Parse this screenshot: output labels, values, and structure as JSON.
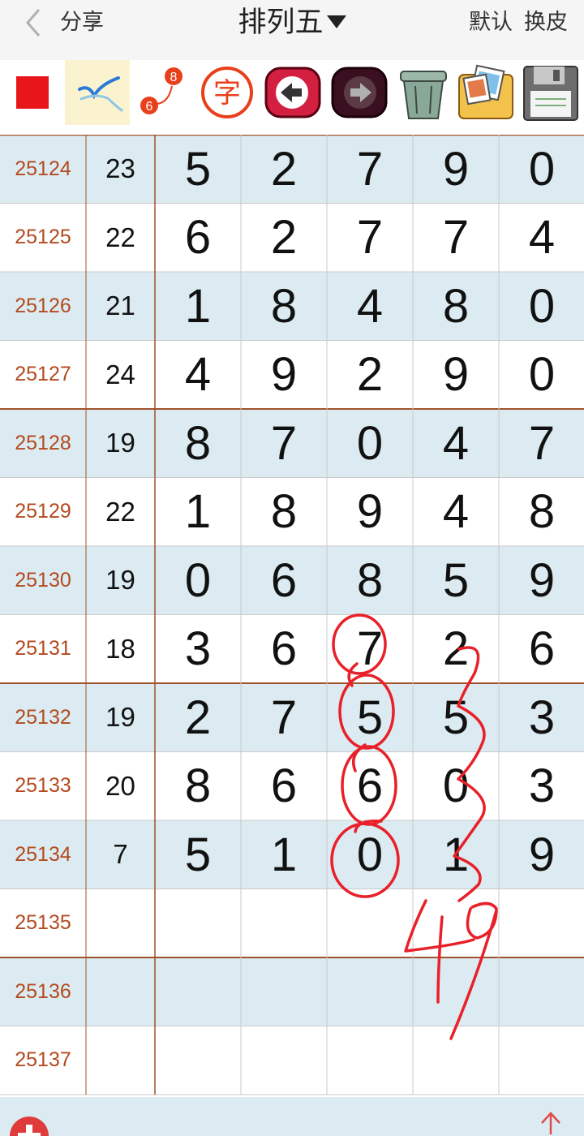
{
  "header": {
    "share_label": "分享",
    "title": "排列五",
    "default_label": "默认",
    "skin_label": "换皮"
  },
  "toolbar": {
    "items": [
      {
        "icon": "red-square-icon"
      },
      {
        "icon": "pen-check-icon"
      },
      {
        "icon": "path-6-8-icon",
        "from": "6",
        "to": "8"
      },
      {
        "icon": "char-icon",
        "glyph": "字"
      },
      {
        "icon": "back-arrow-icon"
      },
      {
        "icon": "forward-arrow-icon"
      },
      {
        "icon": "trash-icon"
      },
      {
        "icon": "photo-folder-icon"
      },
      {
        "icon": "save-disk-icon"
      }
    ]
  },
  "rows": [
    {
      "issue": "25124",
      "sum": "23",
      "digits": [
        "5",
        "2",
        "7",
        "9",
        "0"
      ]
    },
    {
      "issue": "25125",
      "sum": "22",
      "digits": [
        "6",
        "2",
        "7",
        "7",
        "4"
      ]
    },
    {
      "issue": "25126",
      "sum": "21",
      "digits": [
        "1",
        "8",
        "4",
        "8",
        "0"
      ]
    },
    {
      "issue": "25127",
      "sum": "24",
      "digits": [
        "4",
        "9",
        "2",
        "9",
        "0"
      ]
    },
    {
      "issue": "25128",
      "sum": "19",
      "digits": [
        "8",
        "7",
        "0",
        "4",
        "7"
      ]
    },
    {
      "issue": "25129",
      "sum": "22",
      "digits": [
        "1",
        "8",
        "9",
        "4",
        "8"
      ]
    },
    {
      "issue": "25130",
      "sum": "19",
      "digits": [
        "0",
        "6",
        "8",
        "5",
        "9"
      ]
    },
    {
      "issue": "25131",
      "sum": "18",
      "digits": [
        "3",
        "6",
        "7",
        "2",
        "6"
      ]
    },
    {
      "issue": "25132",
      "sum": "19",
      "digits": [
        "2",
        "7",
        "5",
        "5",
        "3"
      ]
    },
    {
      "issue": "25133",
      "sum": "20",
      "digits": [
        "8",
        "6",
        "6",
        "0",
        "3"
      ]
    },
    {
      "issue": "25134",
      "sum": "7",
      "digits": [
        "5",
        "1",
        "0",
        "1",
        "9"
      ]
    },
    {
      "issue": "25135",
      "sum": "",
      "digits": [
        "",
        "",
        "",
        "",
        ""
      ]
    },
    {
      "issue": "25136",
      "sum": "",
      "digits": [
        "",
        "",
        "",
        "",
        ""
      ]
    },
    {
      "issue": "25137",
      "sum": "",
      "digits": [
        "",
        "",
        "",
        "",
        ""
      ]
    }
  ],
  "handwriting": {
    "note": "49",
    "color": "#e8202a"
  },
  "colors": {
    "row_shade": "#dcebf1",
    "issue_text": "#b34a1e",
    "grid_line": "#a0522d",
    "accent_red": "#e8202a"
  }
}
